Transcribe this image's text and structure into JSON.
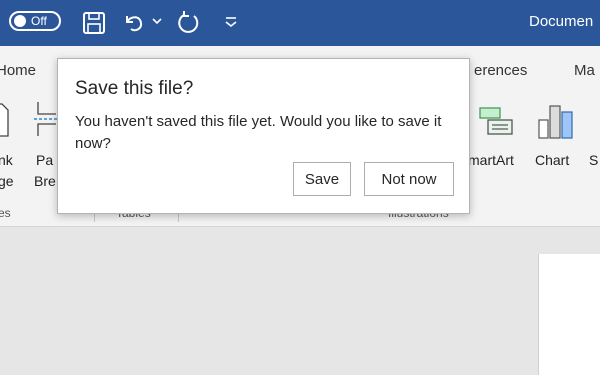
{
  "titlebar": {
    "autosave_state": "Off",
    "document_title": "Documen",
    "icons": [
      "save-icon",
      "undo-icon",
      "chevron-down-icon",
      "redo-icon",
      "customize-qat-icon"
    ],
    "color": "#2b579a"
  },
  "tabs": [
    {
      "label": "Home"
    },
    {
      "label": "erences"
    },
    {
      "label": "Ma"
    }
  ],
  "ribbon": {
    "left_buttons": {
      "blank_page_line1": "nk",
      "blank_page_line2": "ge",
      "page_break_line1": "Pa",
      "page_break_line2": "Bre"
    },
    "smartart_label": "martArt",
    "chart_label": "Chart",
    "s_label": "S",
    "group_labels": {
      "pages": "es",
      "tables": "Tables",
      "illustrations": "Illustrations"
    }
  },
  "dialog": {
    "title": "Save this file?",
    "message": "You haven't saved this file yet. Would you like to save it now?",
    "save_label": "Save",
    "not_now_label": "Not now"
  }
}
